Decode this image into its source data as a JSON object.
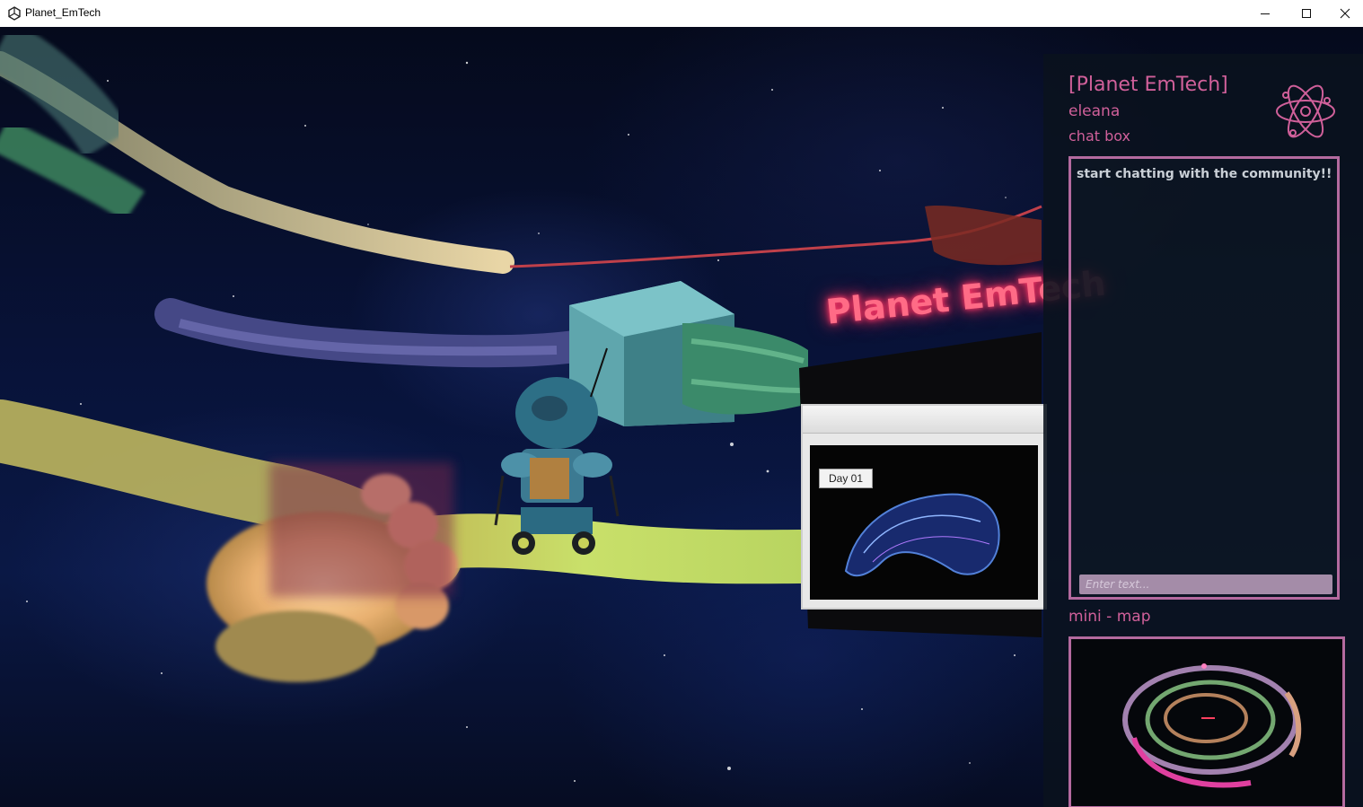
{
  "window": {
    "title": "Planet_EmTech"
  },
  "scene": {
    "sign_text": "Planet EmTech",
    "screen_label": "Day 01"
  },
  "hud": {
    "title": "[Planet EmTech]",
    "username": "eleana",
    "chat_label": "chat box",
    "chat_message": "start chatting with the community!!",
    "chat_placeholder": "Enter text...",
    "minimap_label": "mini - map"
  },
  "colors": {
    "accent": "#d0609a",
    "panel_border": "#b46a9f",
    "sign_glow": "#ff2d5c"
  },
  "icons": {
    "app": "unity-logo-icon",
    "hud": "atom-icon"
  }
}
